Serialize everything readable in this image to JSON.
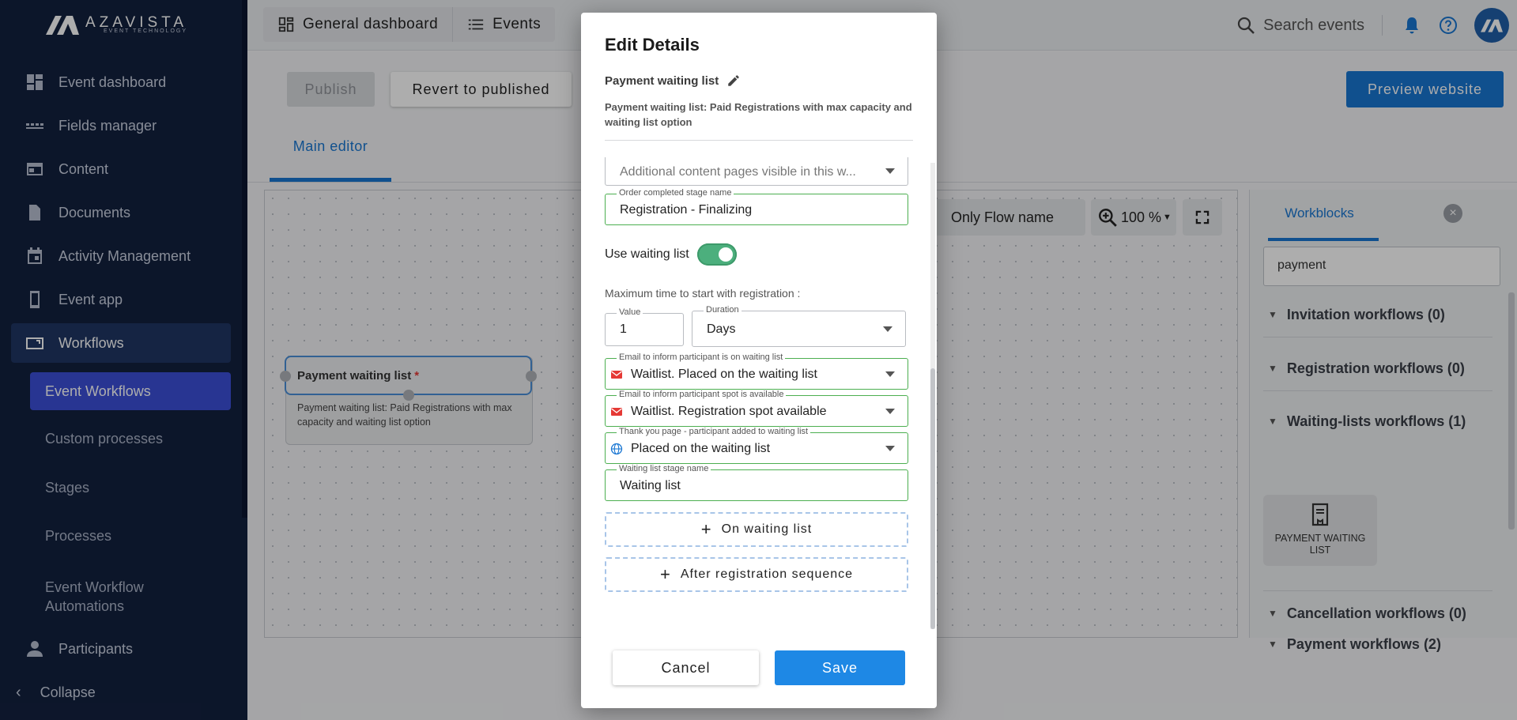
{
  "brand": {
    "name": "AZAVISTA",
    "tagline": "EVENT TECHNOLOGY",
    "accent": "#1976d2",
    "sidebar_bg": "#13213f"
  },
  "sidebar": {
    "items": [
      {
        "label": "Event dashboard",
        "icon": "dashboard-icon"
      },
      {
        "label": "Fields manager",
        "icon": "fields-icon"
      },
      {
        "label": "Content",
        "icon": "content-icon"
      },
      {
        "label": "Documents",
        "icon": "document-icon"
      },
      {
        "label": "Activity Management",
        "icon": "calendar-icon"
      },
      {
        "label": "Event app",
        "icon": "phone-icon"
      },
      {
        "label": "Workflows",
        "icon": "workflow-icon",
        "active": true
      }
    ],
    "sub_items": [
      {
        "label": "Event Workflows",
        "active": true
      },
      {
        "label": "Custom processes"
      },
      {
        "label": "Stages"
      },
      {
        "label": "Processes"
      },
      {
        "label": "Event Workflow Automations"
      }
    ],
    "participants": {
      "label": "Participants",
      "icon": "person-icon"
    },
    "collapse_label": "Collapse"
  },
  "topbar": {
    "nav": [
      {
        "label": "General dashboard",
        "icon": "dashboard-icon"
      },
      {
        "label": "Events",
        "icon": "list-icon"
      }
    ],
    "search_placeholder": "Search events"
  },
  "editor": {
    "publish_label": "Publish",
    "revert_label": "Revert to published",
    "preview_label": "Preview website",
    "tab_label": "Main editor",
    "toolbar": {
      "flow_filter": "Only Flow name",
      "zoom": "100 %"
    },
    "node": {
      "title": "Payment waiting list",
      "required_mark": "*",
      "description": "Payment waiting list: Paid Registrations with max capacity and waiting list option"
    }
  },
  "workblocks": {
    "tab_label": "Workblocks",
    "search_value": "payment",
    "categories": [
      {
        "label": "Invitation workflows (0)"
      },
      {
        "label": "Registration workflows (0)"
      },
      {
        "label": "Waiting-lists workflows (1)"
      },
      {
        "label": "Cancellation workflows (0)"
      },
      {
        "label": "Payment workflows (2)"
      }
    ],
    "card_label": "PAYMENT WAITING LIST"
  },
  "modal": {
    "title": "Edit Details",
    "subtitle": "Payment waiting list",
    "description": "Payment waiting list: Paid Registrations with max capacity and waiting list option",
    "additional_pages_placeholder": "Additional content pages visible in this w...",
    "order_stage": {
      "label": "Order completed stage name",
      "value": "Registration - Finalizing"
    },
    "use_waiting_list": {
      "label": "Use waiting list",
      "checked": true
    },
    "max_time_label": "Maximum time to start with registration :",
    "value_field": {
      "label": "Value",
      "value": "1"
    },
    "duration_field": {
      "label": "Duration",
      "value": "Days"
    },
    "email_waiting": {
      "label": "Email to inform participant is on waiting list",
      "value": "Waitlist. Placed on the waiting list"
    },
    "email_spot": {
      "label": "Email to inform participant spot is available",
      "value": "Waitlist. Registration spot available"
    },
    "thankyou_page": {
      "label": "Thank you page - participant added to waiting list",
      "value": "Placed on the waiting list"
    },
    "waiting_stage": {
      "label": "Waiting list stage name",
      "value": "Waiting list"
    },
    "on_waiting_list_label": "On waiting list",
    "after_registration_label": "After registration sequence",
    "cancel_label": "Cancel",
    "save_label": "Save"
  }
}
